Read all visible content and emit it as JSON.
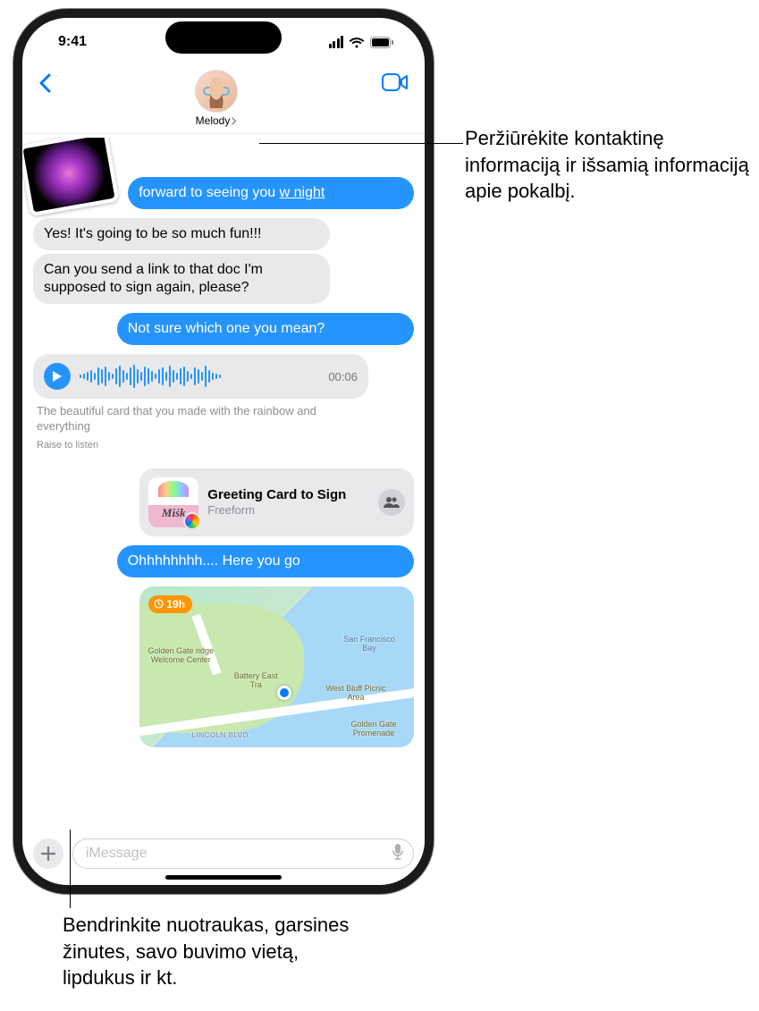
{
  "status": {
    "time": "9:41"
  },
  "header": {
    "contact_name": "Melody"
  },
  "messages": {
    "sent1_prefix": "forward to seeing you",
    "sent1_link": "w night",
    "recv1": "Yes! It's going to be so much fun!!!",
    "recv2": "Can you send a link to that doc I'm supposed to sign again, please?",
    "sent2": "Not sure which one you mean?",
    "audio_duration": "00:06",
    "audio_transcript": "The beautiful card that you made with the rainbow and everything",
    "raise_to_listen": "Raise to listen",
    "link_title": "Greeting Card to Sign",
    "link_source": "Freeform",
    "link_thumb_text": "Miśk",
    "sent3": "Ohhhhhhhh.... Here you go",
    "map_badge": "19h",
    "map_labels": {
      "l1": "Golden Gate ridge Welcome Center",
      "l2": "Battery East Tra",
      "l3": "San Francisco Bay",
      "l4": "West Bluff Picnic Area",
      "l5": "Golden Gate Promenade",
      "l6": "LINCOLN BLVD"
    }
  },
  "input": {
    "placeholder": "iMessage"
  },
  "callouts": {
    "c1": "Peržiūrėkite kontaktinę informaciją ir išsamią informaciją apie pokalbį.",
    "c2": "Bendrinkite nuotraukas, garsines žinutes, savo buvimo vietą, lipdukus ir kt."
  }
}
